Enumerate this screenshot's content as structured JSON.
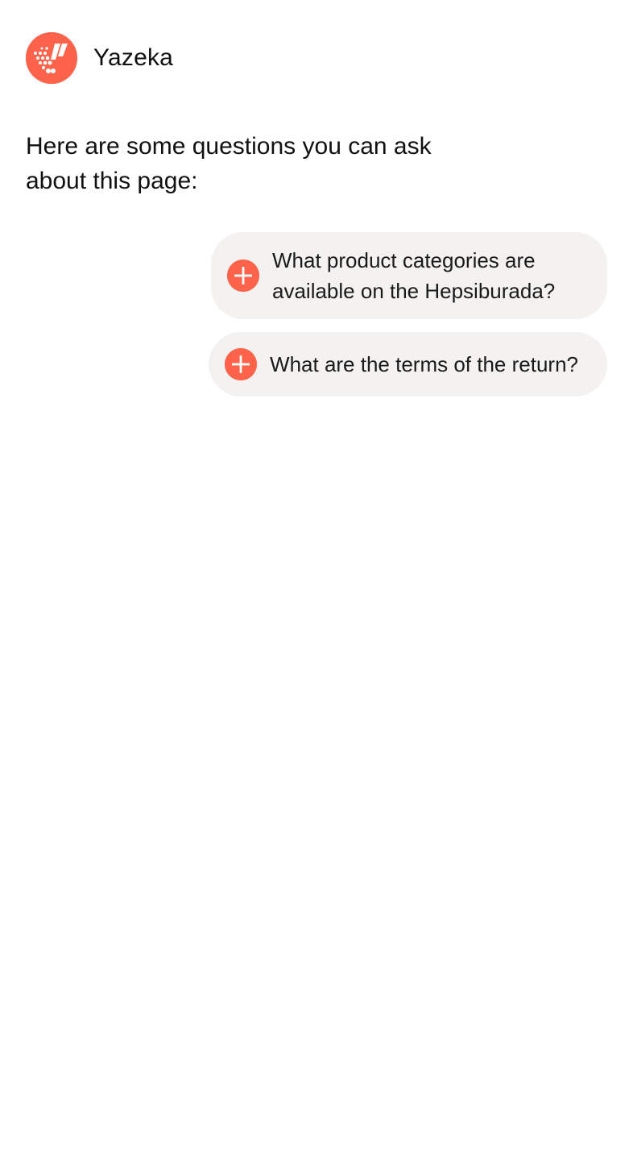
{
  "header": {
    "brand_name": "Yazeka",
    "logo_icon": "yazeka-logo-icon"
  },
  "intro": {
    "text": "Here are some questions you can ask about this page:"
  },
  "suggestions": [
    {
      "label": "What product categories are available on the Hepsiburada?",
      "icon": "plus-icon"
    },
    {
      "label": "What are the terms of the return?",
      "icon": "plus-icon"
    }
  ],
  "colors": {
    "accent": "#fd624a",
    "chip_background": "#f3f2f0",
    "text": "#1a1a1a",
    "page_background": "#ffffff"
  }
}
